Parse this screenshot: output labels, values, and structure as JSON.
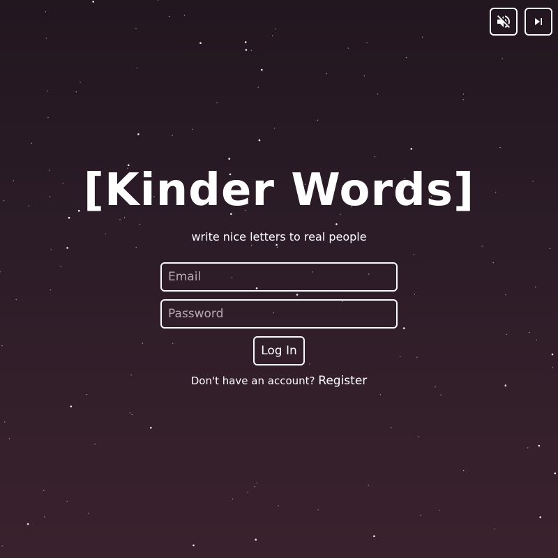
{
  "header": {
    "mute_button": {
      "icon": "volume-off-icon",
      "color": "#ffffff"
    },
    "skip_button": {
      "icon": "skip-next-icon",
      "color": "#ffffff"
    }
  },
  "app": {
    "title": "[Kinder Words]",
    "tagline": "write nice letters to real people"
  },
  "login_form": {
    "email_placeholder": "Email",
    "email_value": "",
    "password_placeholder": "Password",
    "password_value": "",
    "login_label": "Log In"
  },
  "register": {
    "prompt": "Don't have an account?",
    "link_label": "Register"
  },
  "colors": {
    "background_top": "#22161f",
    "background_bottom": "#3a222d",
    "foreground": "#ffffff",
    "placeholder": "#b5a9b1"
  }
}
